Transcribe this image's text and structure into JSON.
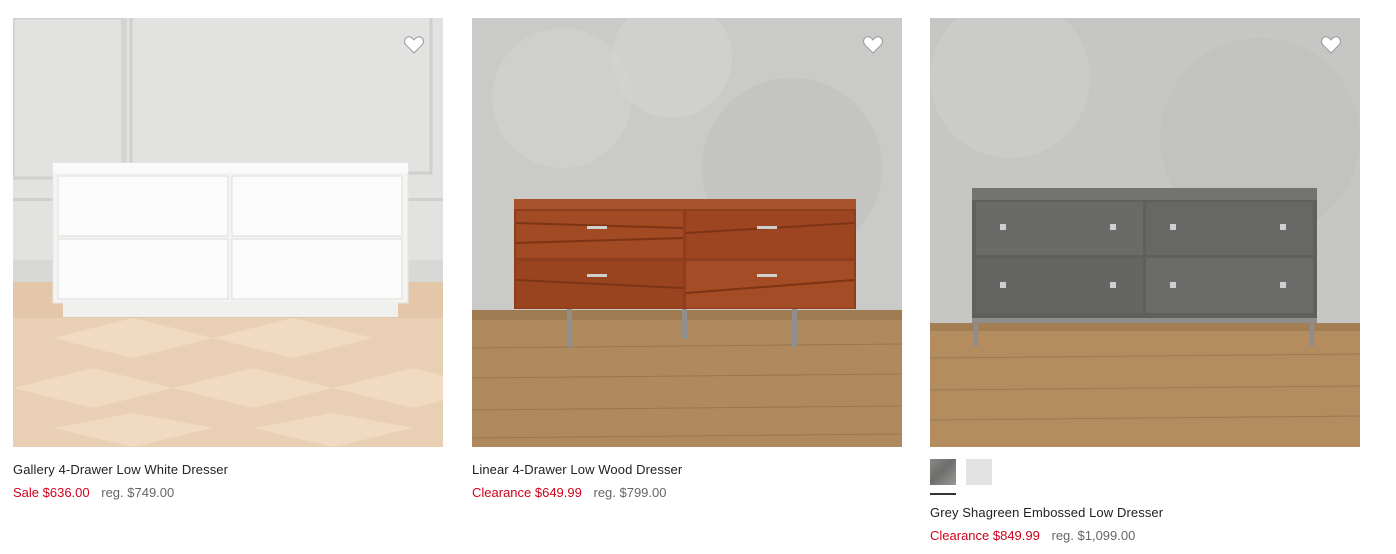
{
  "products": [
    {
      "name": "Gallery 4-Drawer Low White Dresser",
      "sale_price": "Sale $636.00",
      "reg_price": "reg. $749.00",
      "favorite_icon": "heart-icon"
    },
    {
      "name": "Linear 4-Drawer Low Wood Dresser",
      "sale_price": "Clearance $649.99",
      "reg_price": "reg. $799.00",
      "favorite_icon": "heart-icon"
    },
    {
      "name": "Grey Shagreen Embossed Low Dresser",
      "sale_price": "Clearance $849.99",
      "reg_price": "reg. $1,099.00",
      "favorite_icon": "heart-icon",
      "swatches": [
        "grey",
        "light-grey"
      ]
    }
  ],
  "colors": {
    "sale_red": "#d0021b",
    "reg_grey": "#666666",
    "text": "#222222"
  }
}
